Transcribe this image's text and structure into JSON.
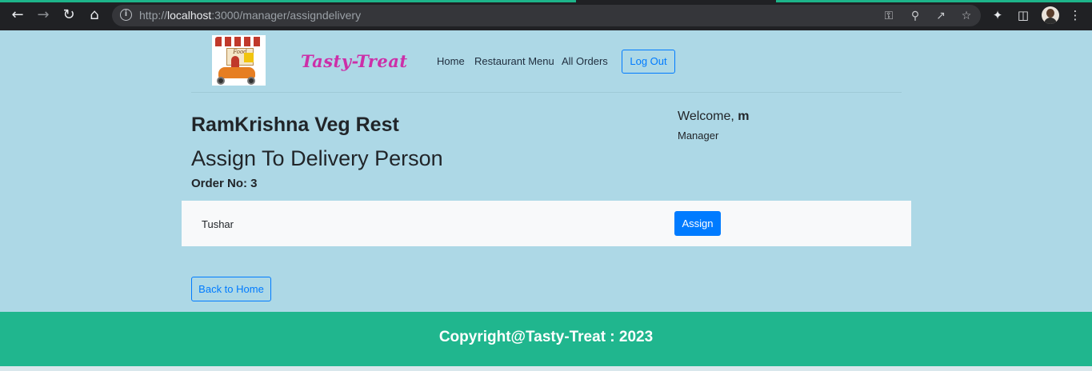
{
  "browser": {
    "url_prefix": "http://",
    "url_host": "localhost",
    "url_rest": ":3000/manager/assigndelivery",
    "icons": [
      "back-icon",
      "forward-icon",
      "reload-icon",
      "home-icon",
      "info-icon",
      "key-icon",
      "zoom-out-icon",
      "share-icon",
      "star-icon",
      "extensions-icon",
      "sidebar-icon",
      "profile-avatar",
      "more-icon"
    ]
  },
  "navbar": {
    "brand": "Tasty-Treat",
    "logo_text": "Food",
    "links": [
      "Home",
      "Restaurant Menu",
      "All Orders"
    ],
    "logout_label": "Log Out"
  },
  "main": {
    "restaurant_name": "RamKrishna Veg Rest",
    "heading": "Assign To Delivery Person",
    "order_label": "Order No: 3",
    "welcome_prefix": "Welcome, ",
    "welcome_user": "m",
    "role": "Manager",
    "delivery_persons": [
      {
        "name": "Tushar",
        "action_label": "Assign"
      }
    ],
    "back_label": "Back to Home"
  },
  "footer": {
    "text": "Copyright@Tasty-Treat : 2023"
  },
  "colors": {
    "page_bg": "#add8e6",
    "brand": "#cc2fa8",
    "primary": "#007bff",
    "footer_bg": "#20b68e"
  }
}
